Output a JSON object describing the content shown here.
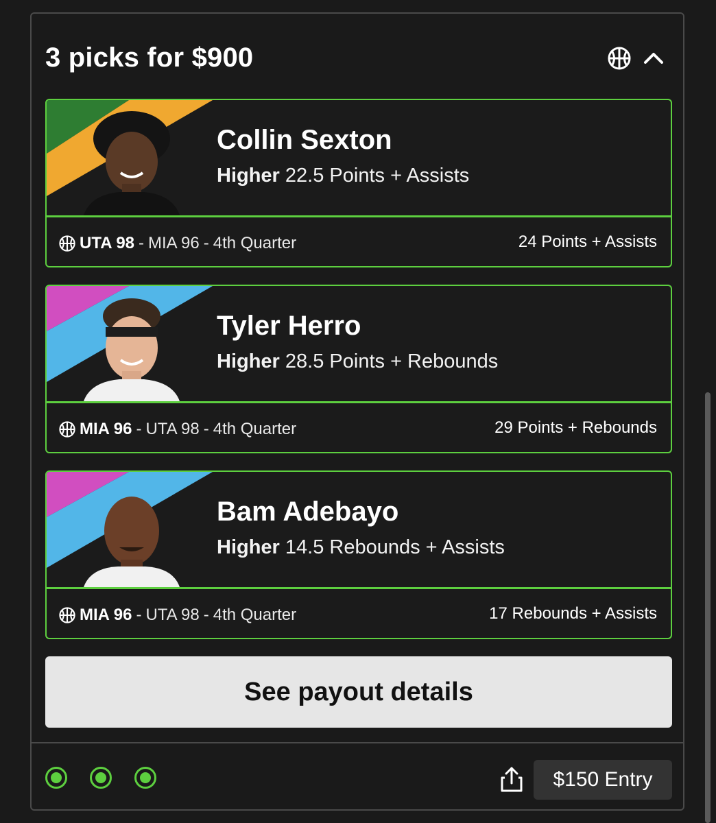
{
  "header": {
    "title": "3 picks for $900",
    "sport_icon": "basketball-icon",
    "collapse_icon": "chevron-up-icon"
  },
  "picks": [
    {
      "player": "Collin Sexton",
      "direction": "Higher",
      "line": "22.5 Points + Assists",
      "team_score": "UTA 98",
      "opp_score": "MIA 96",
      "period": "4th Quarter",
      "result": "24 Points + Assists",
      "stripe_colors": [
        "#2e7d32",
        "#f0a830"
      ]
    },
    {
      "player": "Tyler Herro",
      "direction": "Higher",
      "line": "28.5 Points + Rebounds",
      "team_score": "MIA 96",
      "opp_score": "UTA 98",
      "period": "4th Quarter",
      "result": "29 Points + Rebounds",
      "stripe_colors": [
        "#d14ec0",
        "#52b6e8"
      ]
    },
    {
      "player": "Bam Adebayo",
      "direction": "Higher",
      "line": "14.5 Rebounds + Assists",
      "team_score": "MIA 96",
      "opp_score": "UTA 98",
      "period": "4th Quarter",
      "result": "17 Rebounds + Assists",
      "stripe_colors": [
        "#d14ec0",
        "#52b6e8"
      ]
    }
  ],
  "payout_button": "See payout details",
  "footer": {
    "status_dots": 3,
    "share_icon": "share-icon",
    "entry_label": "$150 Entry"
  },
  "colors": {
    "accent": "#5dcf3f",
    "background": "#1a1a1a",
    "button_bg": "#e6e6e6"
  }
}
